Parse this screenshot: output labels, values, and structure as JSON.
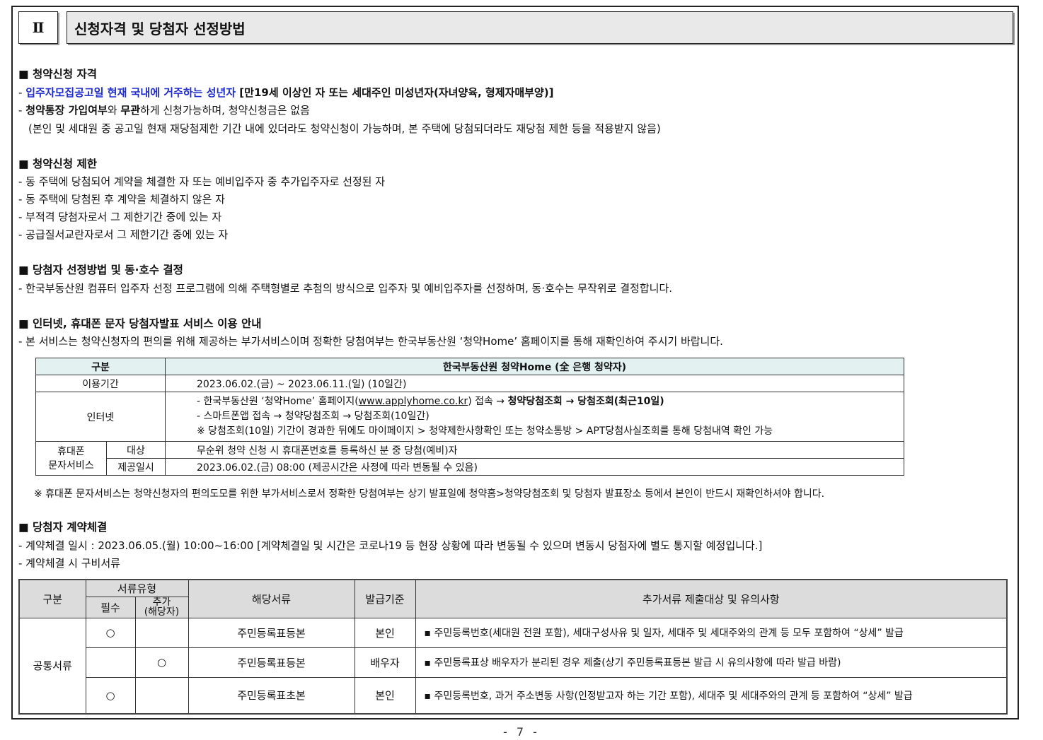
{
  "header": {
    "number": "Ⅱ",
    "title": "신청자격 및 당첨자 선정방법"
  },
  "s1": {
    "heading": "■ 청약신청 자격",
    "l1_prefix": "- ",
    "l1_blue": "입주자모집공고일 현재 국내에 거주하는 성년자",
    "l1_rest": " [만19세 이상인 자 또는 세대주인 미성년자(자녀양육, 형제자매부양)]",
    "l2_prefix": "- ",
    "l2_b1": "청약통장 가입여부",
    "l2_m": "와 ",
    "l2_b2": "무관",
    "l2_rest": "하게 신청가능하며, 청약신청금은 없음",
    "l3": "(본인 및 세대원 중 공고일 현재 재당첨제한 기간 내에 있더라도 청약신청이 가능하며, 본 주택에 당첨되더라도 재당첨 제한 등을 적용받지 않음)"
  },
  "s2": {
    "heading": "■ 청약신청 제한",
    "items": [
      "- 동 주택에 당첨되어 계약을 체결한 자 또는 예비입주자 중 추가입주자로 선정된 자",
      "- 동 주택에 당첨된 후 계약을 체결하지 않은 자",
      "- 부적격 당첨자로서 그 제한기간 중에 있는 자",
      "- 공급질서교란자로서 그 제한기간 중에 있는 자"
    ]
  },
  "s3": {
    "heading": "■ 당첨자 선정방법 및 동·호수 결정",
    "line": "- 한국부동산원 컴퓨터 입주자 선정 프로그램에 의해 주택형별로 추첨의 방식으로 입주자 및 예비입주자를 선정하며, 동·호수는 무작위로 결정합니다."
  },
  "s4": {
    "heading": "■ 인터넷, 휴대폰 문자 당첨자발표 서비스 이용 안내",
    "line": " - 본 서비스는 청약신청자의 편의를 위해 제공하는 부가서비스이며 정확한 당첨여부는 한국부동산원 ‘청약Home’ 홈페이지를 통해 재확인하여 주시기 바랍니다.",
    "table": {
      "h1": "구분",
      "h2": "한국부동산원 청약Home (全 은행 청약자)",
      "r1_label": "이용기간",
      "r1_value": "2023.06.02.(금) ~ 2023.06.11.(일) (10일간)",
      "r2_label": "인터넷",
      "r2_a1": "- 한국부동산원 ‘청약Home’ 홈페이지(",
      "r2_a_link": "www.applyhome.co.kr",
      "r2_a2": ") 접속 → ",
      "r2_a_b": "청약당첨조회 → 당첨조회(최근10일)",
      "r2_b": "- 스마트폰앱 접속  → 청약당첨조회 → 당첨조회(10일간)",
      "r2_c": "※ 당첨조회(10일) 기간이 경과한 뒤에도 마이페이지 > 청약제한사항확인 또는 청약소통방 > APT당첨사실조회를 통해 당첨내역 확인 가능",
      "r3_label": "휴대폰\n문자서비스",
      "r3_sub1": "대상",
      "r3_val1": "무순위 청약 신청 시 휴대폰번호를 등록하신 분 중 당첨(예비)자",
      "r3_sub2": "제공일시",
      "r3_val2": "2023.06.02.(금) 08:00 (제공시간은 사정에 따라 변동될 수 있음)"
    },
    "note": "※ 휴대폰 문자서비스는 청약신청자의 편의도모를 위한 부가서비스로서 정확한 당첨여부는 상기 발표일에 청약홈>청약당첨조회 및 당첨자 발표장소 등에서 본인이 반드시 재확인하셔야 합니다."
  },
  "s5": {
    "heading": "■ 당첨자 계약체결",
    "l1": "- 계약체결 일시 : 2023.06.05.(월) 10:00~16:00 [계약체결일 및 시간은 코로나19 등 현장 상황에 따라 변동될 수 있으며 변동시 당첨자에 별도 통지할 예정입니다.]",
    "l2": "- 계약체결 시 구비서류",
    "table": {
      "h_gubun": "구분",
      "h_type": "서류유형",
      "h_req": "필수",
      "h_add": "추가\n(해당자)",
      "h_doc": "해당서류",
      "h_basis": "발급기준",
      "h_note": "추가서류 제출대상 및 유의사항",
      "group": "공통서류",
      "rows": [
        {
          "req": "○",
          "add": "",
          "doc": "주민등록표등본",
          "basis": "본인",
          "note": "▪ 주민등록번호(세대원 전원 포함), 세대구성사유 및 일자, 세대주 및 세대주와의 관계 등 모두 포함하여 “상세” 발급"
        },
        {
          "req": "",
          "add": "○",
          "doc": "주민등록표등본",
          "basis": "배우자",
          "note": "▪ 주민등록표상 배우자가 분리된 경우 제출(상기 주민등록표등본 발급 시 유의사항에 따라 발급 바람)"
        },
        {
          "req": "○",
          "add": "",
          "doc": "주민등록표초본",
          "basis": "본인",
          "note": "▪ 주민등록번호, 과거 주소변동 사항(인정받고자 하는 기간 포함), 세대주 및 세대주와의 관계 등 포함하여 “상세” 발급"
        }
      ]
    }
  },
  "page": "- 7 -"
}
